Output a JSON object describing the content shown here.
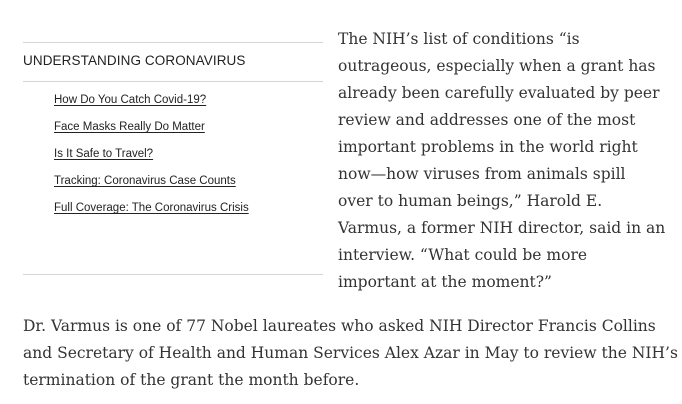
{
  "sidebar": {
    "heading": "UNDERSTANDING CORONAVIRUS",
    "links": [
      "How Do You Catch Covid-19?",
      "Face Masks Really Do Matter",
      "Is It Safe to Travel?",
      "Tracking: Coronavirus Case Counts",
      "Full Coverage: The Coronavirus Crisis"
    ]
  },
  "article": {
    "right_lines": [
      "The NIH’s list of conditions “is",
      "outrageous, especially when a grant has",
      "already been carefully evaluated by peer",
      "review and addresses one of the most",
      "important problems in the world right",
      "now—how viruses from animals spill",
      "over to human beings,” Harold E.",
      "Varmus, a former NIH director, said in an",
      "interview. “What could be more",
      "important at the moment?”"
    ],
    "bottom_lines": [
      "Dr. Varmus is one of 77 Nobel laureates who asked NIH Director Francis Collins",
      "and Secretary of Health and Human Services Alex Azar in May to review the NIH’s",
      "termination of the grant the month before."
    ]
  }
}
